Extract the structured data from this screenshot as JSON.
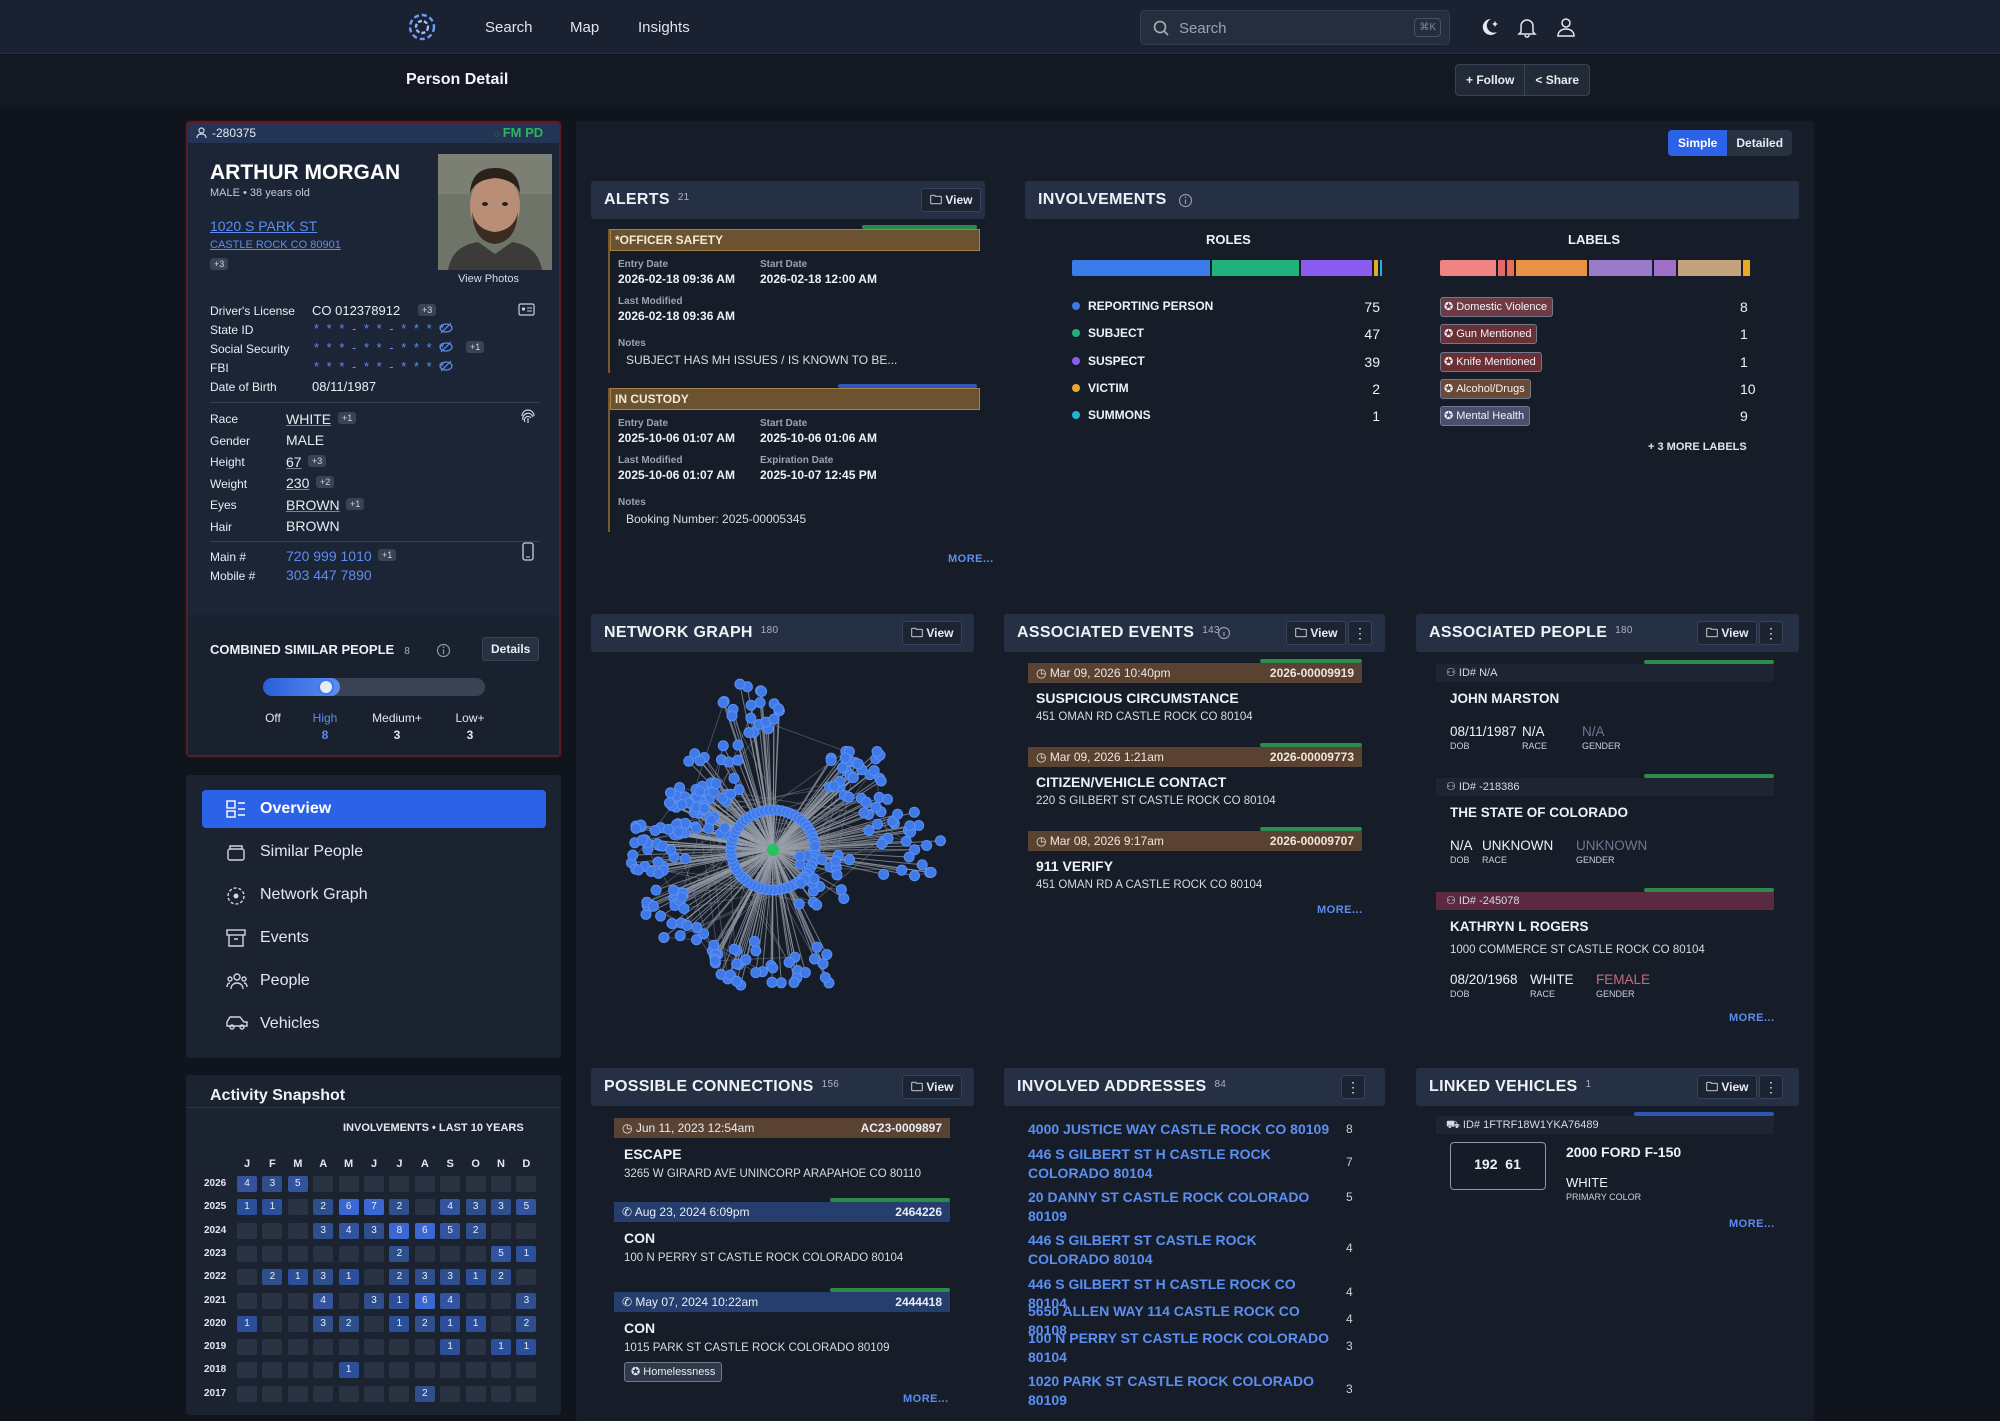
{
  "nav": {
    "items": [
      "Search",
      "Map",
      "Insights"
    ],
    "search_placeholder": "Search",
    "search_kbd": "⌘K"
  },
  "page": {
    "title": "Person Detail",
    "follow": "+ Follow",
    "share": "Share"
  },
  "person": {
    "id": "-280375",
    "agency": "FM PD",
    "name": "ARTHUR MORGAN",
    "sex_age": "MALE • 38 years old",
    "address1": "1020 S PARK ST",
    "address2": "CASTLE ROCK CO 80901",
    "address_more": "+3",
    "view_photos": "View Photos",
    "dl_label": "Driver's License",
    "dl": "CO 012378912",
    "dl_more": "+3",
    "stateid_label": "State ID",
    "ssn_label": "Social Security",
    "ssn_more": "+1",
    "fbi_label": "FBI",
    "masked": "* * * - * * - * * * *",
    "dob_label": "Date of Birth",
    "dob": "08/11/1987",
    "race_label": "Race",
    "race": "WHITE",
    "race_more": "+1",
    "gender_label": "Gender",
    "gender": "MALE",
    "height_label": "Height",
    "height": "67",
    "height_more": "+3",
    "weight_label": "Weight",
    "weight": "230",
    "weight_more": "+2",
    "eyes_label": "Eyes",
    "eyes": "BROWN",
    "eyes_more": "+1",
    "hair_label": "Hair",
    "hair": "BROWN",
    "main_label": "Main #",
    "main": "720 999 1010",
    "main_more": "+1",
    "mobile_label": "Mobile #",
    "mobile": "303 447 7890"
  },
  "similar": {
    "title": "COMBINED SIMILAR PEOPLE",
    "count": "8",
    "details": "Details",
    "levels": [
      {
        "label": "Off",
        "count": ""
      },
      {
        "label": "High",
        "count": "8"
      },
      {
        "label": "Medium+",
        "count": "3"
      },
      {
        "label": "Low+",
        "count": "3"
      }
    ],
    "selected_level": "High"
  },
  "menu": {
    "items": [
      "Overview",
      "Similar People",
      "Network Graph",
      "Events",
      "People",
      "Vehicles"
    ],
    "active": "Overview"
  },
  "activity": {
    "title": "Activity Snapshot",
    "subtitle": "INVOLVEMENTS • LAST 10 YEARS",
    "months": [
      "J",
      "F",
      "M",
      "A",
      "M",
      "J",
      "J",
      "A",
      "S",
      "O",
      "N",
      "D"
    ],
    "rows": [
      {
        "year": "2026",
        "cells": [
          4,
          3,
          5,
          0,
          0,
          0,
          0,
          0,
          0,
          0,
          0,
          0
        ]
      },
      {
        "year": "2025",
        "cells": [
          1,
          1,
          0,
          2,
          6,
          7,
          2,
          0,
          4,
          3,
          3,
          5
        ]
      },
      {
        "year": "2024",
        "cells": [
          0,
          0,
          0,
          3,
          4,
          3,
          8,
          6,
          5,
          2,
          0,
          0
        ]
      },
      {
        "year": "2023",
        "cells": [
          0,
          0,
          0,
          0,
          0,
          0,
          2,
          0,
          0,
          0,
          5,
          1
        ]
      },
      {
        "year": "2022",
        "cells": [
          0,
          2,
          1,
          3,
          1,
          0,
          2,
          3,
          3,
          1,
          2,
          0
        ]
      },
      {
        "year": "2021",
        "cells": [
          0,
          0,
          0,
          4,
          0,
          3,
          1,
          6,
          4,
          0,
          0,
          3
        ]
      },
      {
        "year": "2020",
        "cells": [
          1,
          0,
          0,
          3,
          2,
          0,
          1,
          2,
          1,
          1,
          0,
          2
        ]
      },
      {
        "year": "2019",
        "cells": [
          0,
          0,
          0,
          0,
          0,
          0,
          0,
          0,
          1,
          0,
          1,
          1
        ]
      },
      {
        "year": "2018",
        "cells": [
          0,
          0,
          0,
          0,
          1,
          0,
          0,
          0,
          0,
          0,
          0,
          0
        ]
      },
      {
        "year": "2017",
        "cells": [
          0,
          0,
          0,
          0,
          0,
          0,
          0,
          2,
          0,
          0,
          0,
          0
        ]
      }
    ]
  },
  "view_toggle": {
    "simple": "Simple",
    "detailed": "Detailed"
  },
  "alerts": {
    "title": "ALERTS",
    "count": "21",
    "view": "View",
    "more": "MORE...",
    "items": [
      {
        "type": "*OFFICER SAFETY",
        "entry_label": "Entry Date",
        "entry": "2026-02-18 09:36 AM",
        "start_label": "Start Date",
        "start": "2026-02-18 12:00 AM",
        "mod_label": "Last Modified",
        "mod": "2026-02-18 09:36 AM",
        "notes_label": "Notes",
        "notes": "SUBJECT HAS MH ISSUES / IS KNOWN TO BE..."
      },
      {
        "type": "IN CUSTODY",
        "entry_label": "Entry Date",
        "entry": "2025-10-06 01:07 AM",
        "start_label": "Start Date",
        "start": "2025-10-06 01:06 AM",
        "mod_label": "Last Modified",
        "mod": "2025-10-06 01:07 AM",
        "exp_label": "Expiration Date",
        "exp": "2025-10-07 12:45 PM",
        "notes_label": "Notes",
        "notes": "Booking Number: 2025-00005345"
      }
    ]
  },
  "involvements": {
    "title": "INVOLVEMENTS",
    "roles_title": "ROLES",
    "labels_title": "LABELS",
    "more_labels": "+ 3 MORE LABELS",
    "roles": [
      {
        "name": "REPORTING PERSON",
        "count": 75,
        "color": "#3b7bea"
      },
      {
        "name": "SUBJECT",
        "count": 47,
        "color": "#22b07d"
      },
      {
        "name": "SUSPECT",
        "count": 39,
        "color": "#8b5cf0"
      },
      {
        "name": "VICTIM",
        "count": 2,
        "color": "#e7a92b"
      },
      {
        "name": "SUMMONS",
        "count": 1,
        "color": "#22b4d8"
      }
    ],
    "labels": [
      {
        "name": "Domestic Violence",
        "count": 8,
        "color": "#6e3a44"
      },
      {
        "name": "Gun Mentioned",
        "count": 1,
        "color": "#6b2f36"
      },
      {
        "name": "Knife Mentioned",
        "count": 1,
        "color": "#6b2f36"
      },
      {
        "name": "Alcohol/Drugs",
        "count": 10,
        "color": "#6b4a35"
      },
      {
        "name": "Mental Health",
        "count": 9,
        "color": "#4a4f6e"
      }
    ],
    "label_bar": [
      {
        "value": 8,
        "color": "#f08383"
      },
      {
        "value": 1,
        "color": "#e86868"
      },
      {
        "value": 1,
        "color": "#f06a5a"
      },
      {
        "value": 10,
        "color": "#e99244"
      },
      {
        "value": 9,
        "color": "#9a7bcb"
      },
      {
        "value": 3,
        "color": "#a070c8"
      },
      {
        "value": 9,
        "color": "#c2a27c"
      },
      {
        "value": 1,
        "color": "#e7a92b"
      }
    ]
  },
  "network": {
    "title": "NETWORK GRAPH",
    "count": "180",
    "view": "View"
  },
  "events": {
    "title": "ASSOCIATED EVENTS",
    "count": "143",
    "view": "View",
    "more": "MORE...",
    "items": [
      {
        "date": "Mar 09, 2026 10:40pm",
        "id": "2026-00009919",
        "title": "SUSPICIOUS CIRCUMSTANCE",
        "address": "451 OMAN RD CASTLE ROCK CO 80104"
      },
      {
        "date": "Mar 09, 2026 1:21am",
        "id": "2026-00009773",
        "title": "CITIZEN/VEHICLE CONTACT",
        "address": "220 S GILBERT ST CASTLE ROCK CO 80104"
      },
      {
        "date": "Mar 08, 2026 9:17am",
        "id": "2026-00009707",
        "title": "911 VERIFY",
        "address": "451 OMAN RD A CASTLE ROCK CO 80104"
      }
    ]
  },
  "people": {
    "title": "ASSOCIATED PEOPLE",
    "count": "180",
    "view": "View",
    "more": "MORE...",
    "dob_label": "DOB",
    "race_label": "RACE",
    "gender_label": "GENDER",
    "items": [
      {
        "id": "ID# N/A",
        "name": "JOHN MARSTON",
        "address": "",
        "dob": "08/11/1987",
        "race": "N/A",
        "gender": "N/A"
      },
      {
        "id": "ID# -218386",
        "name": "THE STATE OF COLORADO",
        "address": "",
        "dob": "N/A",
        "race": "UNKNOWN",
        "gender": "UNKNOWN"
      },
      {
        "id": "ID# -245078",
        "name": "KATHRYN L ROGERS",
        "address": "1000 COMMERCE ST CASTLE ROCK CO 80104",
        "dob": "08/20/1968",
        "race": "WHITE",
        "gender": "FEMALE"
      }
    ]
  },
  "connections": {
    "title": "POSSIBLE CONNECTIONS",
    "count": "156",
    "view": "View",
    "more": "MORE...",
    "items": [
      {
        "date": "Jun 11, 2023 12:54am",
        "id": "AC23-0009897",
        "title": "ESCAPE",
        "address": "3265 W GIRARD AVE UNINCORP ARAPAHOE CO 80110",
        "tag": ""
      },
      {
        "date": "Aug 23, 2024 6:09pm",
        "id": "2464226",
        "title": "CON",
        "address": "100 N PERRY ST CASTLE ROCK COLORADO 80104",
        "tag": ""
      },
      {
        "date": "May 07, 2024 10:22am",
        "id": "2444418",
        "title": "CON",
        "address": "1015 PARK ST CASTLE ROCK COLORADO 80109",
        "tag": "Homelessness"
      }
    ]
  },
  "addresses": {
    "title": "INVOLVED ADDRESSES",
    "count": "84",
    "items": [
      {
        "address": "4000 JUSTICE WAY CASTLE ROCK CO 80109",
        "count": "8"
      },
      {
        "address": "446 S GILBERT ST H CASTLE ROCK COLORADO 80104",
        "count": "7"
      },
      {
        "address": "20 DANNY ST CASTLE ROCK COLORADO 80109",
        "count": "5"
      },
      {
        "address": "446 S GILBERT ST CASTLE ROCK COLORADO 80104",
        "count": "4"
      },
      {
        "address": "446 S GILBERT ST H CASTLE ROCK CO 80104",
        "count": "4"
      },
      {
        "address": "5650 ALLEN WAY 114 CASTLE ROCK CO 80108",
        "count": "4"
      },
      {
        "address": "100 N PERRY ST CASTLE ROCK COLORADO 80104",
        "count": "3"
      },
      {
        "address": "1020 PARK ST CASTLE ROCK COLORADO 80109",
        "count": "3"
      }
    ]
  },
  "vehicles": {
    "title": "LINKED VEHICLES",
    "count": "1",
    "view": "View",
    "more": "MORE...",
    "id": "ID# 1FTRF18W1YKA76489",
    "plate": "192  61",
    "name": "2000 FORD F-150",
    "color": "WHITE",
    "color_label": "PRIMARY COLOR"
  }
}
